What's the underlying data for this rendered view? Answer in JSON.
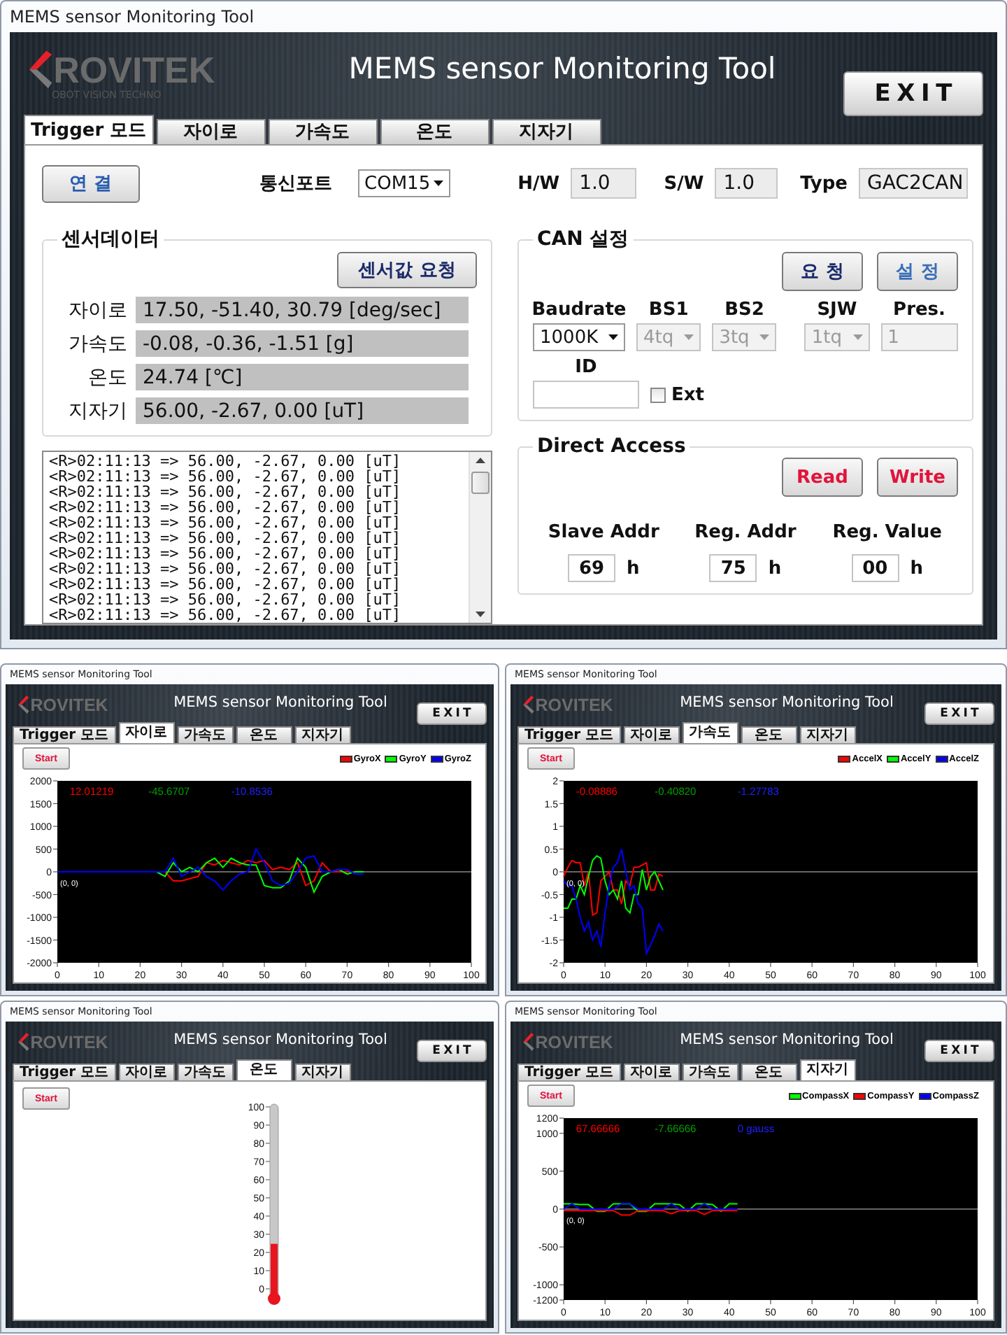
{
  "windows": [
    {
      "kind": "trigger",
      "title": "MEMS sensor Monitoring Tool",
      "logo": "ROVITEK",
      "tagline": "OBOT VISION TECHNO",
      "app_title": "MEMS sensor Monitoring Tool",
      "exit_button": "EXIT",
      "tabs": [
        {
          "label": "Trigger 모드",
          "selected": true
        },
        {
          "label": "자이로",
          "selected": false
        },
        {
          "label": "가속도",
          "selected": false
        },
        {
          "label": "온도",
          "selected": false
        },
        {
          "label": "지자기",
          "selected": false
        }
      ],
      "trigger": {
        "connect_button": "연 결",
        "port": {
          "label": "통신포트",
          "value": "COM15"
        },
        "info": [
          {
            "label": "H/W",
            "value": "1.0"
          },
          {
            "label": "S/W",
            "value": "1.0"
          },
          {
            "label": "Type",
            "value": "GAC2CAN"
          }
        ],
        "sensor": {
          "title": "센서데이터",
          "button": "센서값 요청",
          "rows": [
            {
              "label": "자이로",
              "value": "17.50, -51.40, 30.79 [deg/sec]"
            },
            {
              "label": "가속도",
              "value": "-0.08, -0.36, -1.51 [g]"
            },
            {
              "label": "온도",
              "value": "24.74 [℃]"
            },
            {
              "label": "지자기",
              "value": "56.00, -2.67, 0.00 [uT]"
            }
          ]
        },
        "log": [
          "<R>02:11:13 => 56.00, -2.67, 0.00 [uT]",
          "<R>02:11:13 => 56.00, -2.67, 0.00 [uT]",
          "<R>02:11:13 => 56.00, -2.67, 0.00 [uT]",
          "<R>02:11:13 => 56.00, -2.67, 0.00 [uT]",
          "<R>02:11:13 => 56.00, -2.67, 0.00 [uT]",
          "<R>02:11:13 => 56.00, -2.67, 0.00 [uT]",
          "<R>02:11:13 => 56.00, -2.67, 0.00 [uT]",
          "<R>02:11:13 => 56.00, -2.67, 0.00 [uT]",
          "<R>02:11:13 => 56.00, -2.67, 0.00 [uT]",
          "<R>02:11:13 => 56.00, -2.67, 0.00 [uT]",
          "<R>02:11:13 => 56.00, -2.67, 0.00 [uT]"
        ],
        "can": {
          "title": "CAN 설정",
          "buttons": [
            "요 청",
            "설 정"
          ],
          "fields": [
            {
              "label": "Baudrate",
              "kind": "select",
              "value": "1000K",
              "disabled": false
            },
            {
              "label": "BS1",
              "kind": "select",
              "value": "4tq",
              "disabled": true
            },
            {
              "label": "BS2",
              "kind": "select",
              "value": "3tq",
              "disabled": true
            },
            {
              "label": "SJW",
              "kind": "select",
              "value": "1tq",
              "disabled": true
            },
            {
              "label": "Pres.",
              "kind": "input",
              "value": "1",
              "disabled": true
            }
          ],
          "id_label": "ID",
          "ext": {
            "label": "Ext",
            "checked": false
          }
        },
        "direct": {
          "title": "Direct Access",
          "buttons": [
            "Read",
            "Write"
          ],
          "fields": [
            {
              "label": "Slave Addr",
              "value": "69",
              "unit": "h"
            },
            {
              "label": "Reg. Addr",
              "value": "75",
              "unit": "h"
            },
            {
              "label": "Reg. Value",
              "value": "00",
              "unit": "h"
            }
          ]
        }
      }
    },
    {
      "kind": "chart",
      "title": "MEMS sensor Monitoring Tool",
      "logo": "ROVITEK",
      "app_title": "MEMS sensor Monitoring Tool",
      "exit_button": "EXIT",
      "tabs": [
        {
          "label": "Trigger 모드",
          "selected": false
        },
        {
          "label": "자이로",
          "selected": true
        },
        {
          "label": "가속도",
          "selected": false
        },
        {
          "label": "온도",
          "selected": false
        },
        {
          "label": "지자기",
          "selected": false
        }
      ],
      "start_button": "Start",
      "readouts": [
        {
          "text": "12.01219",
          "color": "#ff0000"
        },
        {
          "text": "-45.6707",
          "color": "#00a000"
        },
        {
          "text": "-10.8536",
          "color": "#2020ff"
        }
      ],
      "origin_label": "(0, 0)",
      "chart_data": {
        "type": "line",
        "x": [
          0,
          24,
          26,
          28,
          30,
          32,
          34,
          36,
          38,
          40,
          42,
          44,
          46,
          48,
          50,
          52,
          54,
          56,
          58,
          60,
          62,
          64,
          66,
          68,
          70,
          72,
          74
        ],
        "series": [
          {
            "name": "GyroX",
            "color": "#ff0000",
            "values": [
              0,
              0,
              0,
              -200,
              -200,
              -150,
              -100,
              200,
              150,
              250,
              200,
              150,
              250,
              200,
              250,
              50,
              100,
              50,
              200,
              -300,
              -200,
              200,
              0,
              0,
              0,
              0,
              0
            ]
          },
          {
            "name": "GyroY",
            "color": "#00ff00",
            "values": [
              0,
              0,
              -100,
              200,
              0,
              100,
              0,
              200,
              300,
              100,
              300,
              200,
              150,
              150,
              -300,
              -350,
              -350,
              -200,
              300,
              100,
              -450,
              -100,
              0,
              50,
              -50,
              0,
              0
            ]
          },
          {
            "name": "GyroZ",
            "color": "#0000ff",
            "values": [
              0,
              0,
              0,
              300,
              -100,
              0,
              100,
              -100,
              -200,
              -400,
              -200,
              -50,
              0,
              500,
              200,
              -200,
              -300,
              -250,
              0,
              300,
              350,
              0,
              0,
              50,
              50,
              -50,
              -50
            ]
          }
        ],
        "xlim": [
          0,
          100
        ],
        "ylim": [
          -2000,
          2000
        ],
        "xticks": [
          0,
          10,
          20,
          30,
          40,
          50,
          60,
          70,
          80,
          90,
          100
        ],
        "yticks": [
          -2000,
          -1500,
          -1000,
          -500,
          0,
          500,
          1000,
          1500,
          2000
        ]
      }
    },
    {
      "kind": "chart",
      "title": "MEMS sensor Monitoring Tool",
      "logo": "ROVITEK",
      "app_title": "MEMS sensor Monitoring Tool",
      "exit_button": "EXIT",
      "tabs": [
        {
          "label": "Trigger 모드",
          "selected": false
        },
        {
          "label": "자이로",
          "selected": false
        },
        {
          "label": "가속도",
          "selected": true
        },
        {
          "label": "온도",
          "selected": false
        },
        {
          "label": "지자기",
          "selected": false
        }
      ],
      "start_button": "Start",
      "readouts": [
        {
          "text": "-0.08886",
          "color": "#ff0000"
        },
        {
          "text": "-0.40820",
          "color": "#00a000"
        },
        {
          "text": "-1.27783",
          "color": "#2020ff"
        }
      ],
      "origin_label": "(0, 0)",
      "chart_data": {
        "type": "line",
        "x": [
          0,
          1,
          2,
          3,
          4,
          5,
          6,
          7,
          8,
          9,
          10,
          11,
          12,
          13,
          14,
          15,
          16,
          17,
          18,
          19,
          20,
          21,
          22,
          23,
          24
        ],
        "series": [
          {
            "name": "AccelX",
            "color": "#ff0000",
            "values": [
              -0.1,
              0.1,
              0.25,
              0.2,
              0.2,
              -0.3,
              0,
              -0.95,
              -0.9,
              -0.2,
              -0.1,
              0,
              -0.4,
              -0.4,
              -0.7,
              -0.2,
              -0.3,
              0.1,
              0.1,
              0.15,
              0.2,
              -0.4,
              -0.4,
              -0.05,
              -0.1
            ]
          },
          {
            "name": "AccelY",
            "color": "#00ff00",
            "values": [
              -0.8,
              -0.8,
              -0.6,
              -0.6,
              -0.3,
              -0.5,
              -0.1,
              0.25,
              0.35,
              0.3,
              -0.2,
              -0.5,
              -0.4,
              -0.6,
              -0.2,
              -0.8,
              -0.9,
              -0.5,
              -0.5,
              0.05,
              -0.4,
              -0.1,
              0,
              -0.2,
              -0.4
            ]
          },
          {
            "name": "AccelZ",
            "color": "#0000ff",
            "values": [
              -0.2,
              -0.3,
              -0.3,
              -0.6,
              -1,
              -1.3,
              -1.1,
              -1.5,
              -1.3,
              -1.65,
              -0.9,
              -0.3,
              0.1,
              0.2,
              0.5,
              0,
              -0.4,
              -0.3,
              -0.7,
              -0.8,
              -1.8,
              -1.6,
              -1.4,
              -1.15,
              -1.3
            ]
          }
        ],
        "xlim": [
          0,
          100
        ],
        "ylim": [
          -2,
          2
        ],
        "xticks": [
          0,
          10,
          20,
          30,
          40,
          50,
          60,
          70,
          80,
          90,
          100
        ],
        "yticks": [
          -2,
          -1.5,
          -1,
          -0.5,
          0,
          0.5,
          1,
          1.5,
          2
        ]
      }
    },
    {
      "kind": "thermo",
      "title": "MEMS sensor Monitoring Tool",
      "logo": "ROVITEK",
      "app_title": "MEMS sensor Monitoring Tool",
      "exit_button": "EXIT",
      "tabs": [
        {
          "label": "Trigger 모드",
          "selected": false
        },
        {
          "label": "자이로",
          "selected": false
        },
        {
          "label": "가속도",
          "selected": false
        },
        {
          "label": "온도",
          "selected": true
        },
        {
          "label": "지자기",
          "selected": false
        }
      ],
      "start_button": "Start",
      "thermometer": {
        "level": 0.2474,
        "ticks": [
          "100",
          "90",
          "80",
          "70",
          "60",
          "50",
          "40",
          "30",
          "20",
          "10",
          "0"
        ]
      }
    },
    {
      "kind": "chart",
      "title": "MEMS sensor Monitoring Tool",
      "logo": "ROVITEK",
      "app_title": "MEMS sensor Monitoring Tool",
      "exit_button": "EXIT",
      "tabs": [
        {
          "label": "Trigger 모드",
          "selected": false
        },
        {
          "label": "자이로",
          "selected": false
        },
        {
          "label": "가속도",
          "selected": false
        },
        {
          "label": "온도",
          "selected": false
        },
        {
          "label": "지자기",
          "selected": true
        }
      ],
      "start_button": "Start",
      "readouts": [
        {
          "text": "67.66666",
          "color": "#ff0000"
        },
        {
          "text": "-7.66666",
          "color": "#00a000"
        },
        {
          "text": "0 gauss",
          "color": "#2020ff"
        }
      ],
      "origin_label": "(0, 0)",
      "chart_data": {
        "type": "line",
        "x": [
          0,
          2,
          4,
          6,
          8,
          10,
          12,
          14,
          16,
          18,
          20,
          22,
          24,
          26,
          28,
          30,
          32,
          34,
          36,
          38,
          40,
          42
        ],
        "series": [
          {
            "name": "CompassX",
            "color": "#00ff00",
            "values": [
              70,
              70,
              60,
              60,
              -30,
              -30,
              70,
              70,
              70,
              -30,
              -30,
              70,
              70,
              70,
              60,
              -30,
              70,
              70,
              60,
              -30,
              70,
              70
            ]
          },
          {
            "name": "CompassY",
            "color": "#ff0000",
            "values": [
              -20,
              -20,
              -20,
              -20,
              -20,
              -20,
              -20,
              -80,
              -80,
              -20,
              -20,
              -20,
              -20,
              -60,
              -20,
              -20,
              -20,
              -70,
              -20,
              -20,
              -20,
              -20
            ]
          },
          {
            "name": "CompassZ",
            "color": "#0000ff",
            "values": [
              0,
              70,
              0,
              0,
              0,
              0,
              0,
              70,
              70,
              0,
              0,
              0,
              0,
              70,
              0,
              0,
              0,
              70,
              0,
              0,
              0,
              0
            ]
          }
        ],
        "xlim": [
          0,
          100
        ],
        "ylim": [
          -1200,
          1200
        ],
        "xticks": [
          0,
          10,
          20,
          30,
          40,
          50,
          60,
          70,
          80,
          90,
          100
        ],
        "yticks": [
          -1200,
          -1000,
          -500,
          0,
          500,
          1000,
          1200
        ]
      }
    }
  ]
}
